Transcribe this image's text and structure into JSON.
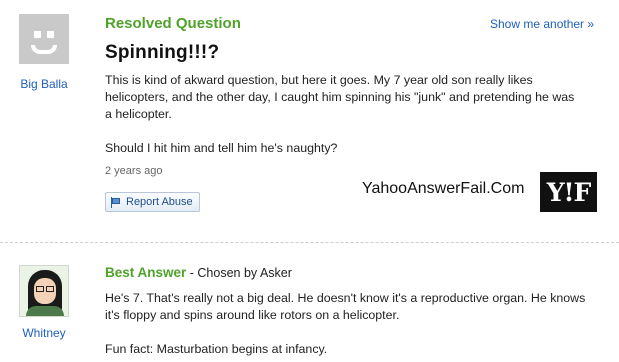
{
  "question": {
    "status_title": "Resolved Question",
    "show_another": "Show me another »",
    "title": "Spinning!!!?",
    "asker": "Big Balla",
    "body": [
      "This is kind of akward question, but here it goes. My 7 year old son really likes helicopters, and the other day, I caught him spinning his \"junk\" and pretending he was a helicopter.",
      "Should I hit him and tell him he's naughty?"
    ],
    "time_ago": "2 years ago",
    "report_label": "Report Abuse"
  },
  "watermark": {
    "text": "YahooAnswerFail.Com",
    "logo_text": "Y!F"
  },
  "answer": {
    "best_label": "Best Answer",
    "chosen_by": "- Chosen by Asker",
    "answerer": "Whitney",
    "body": [
      "He's 7. That's really not a big deal. He doesn't know it's a reproductive organ. He knows it's floppy and spins around like rotors on a helicopter.",
      "Fun fact: Masturbation begins at infancy."
    ]
  },
  "colors": {
    "accent_green": "#4fa32a",
    "link_blue": "#1f5fbd"
  },
  "icons": [
    "default-avatar-icon",
    "flag-icon",
    "user-avatar-icon"
  ]
}
